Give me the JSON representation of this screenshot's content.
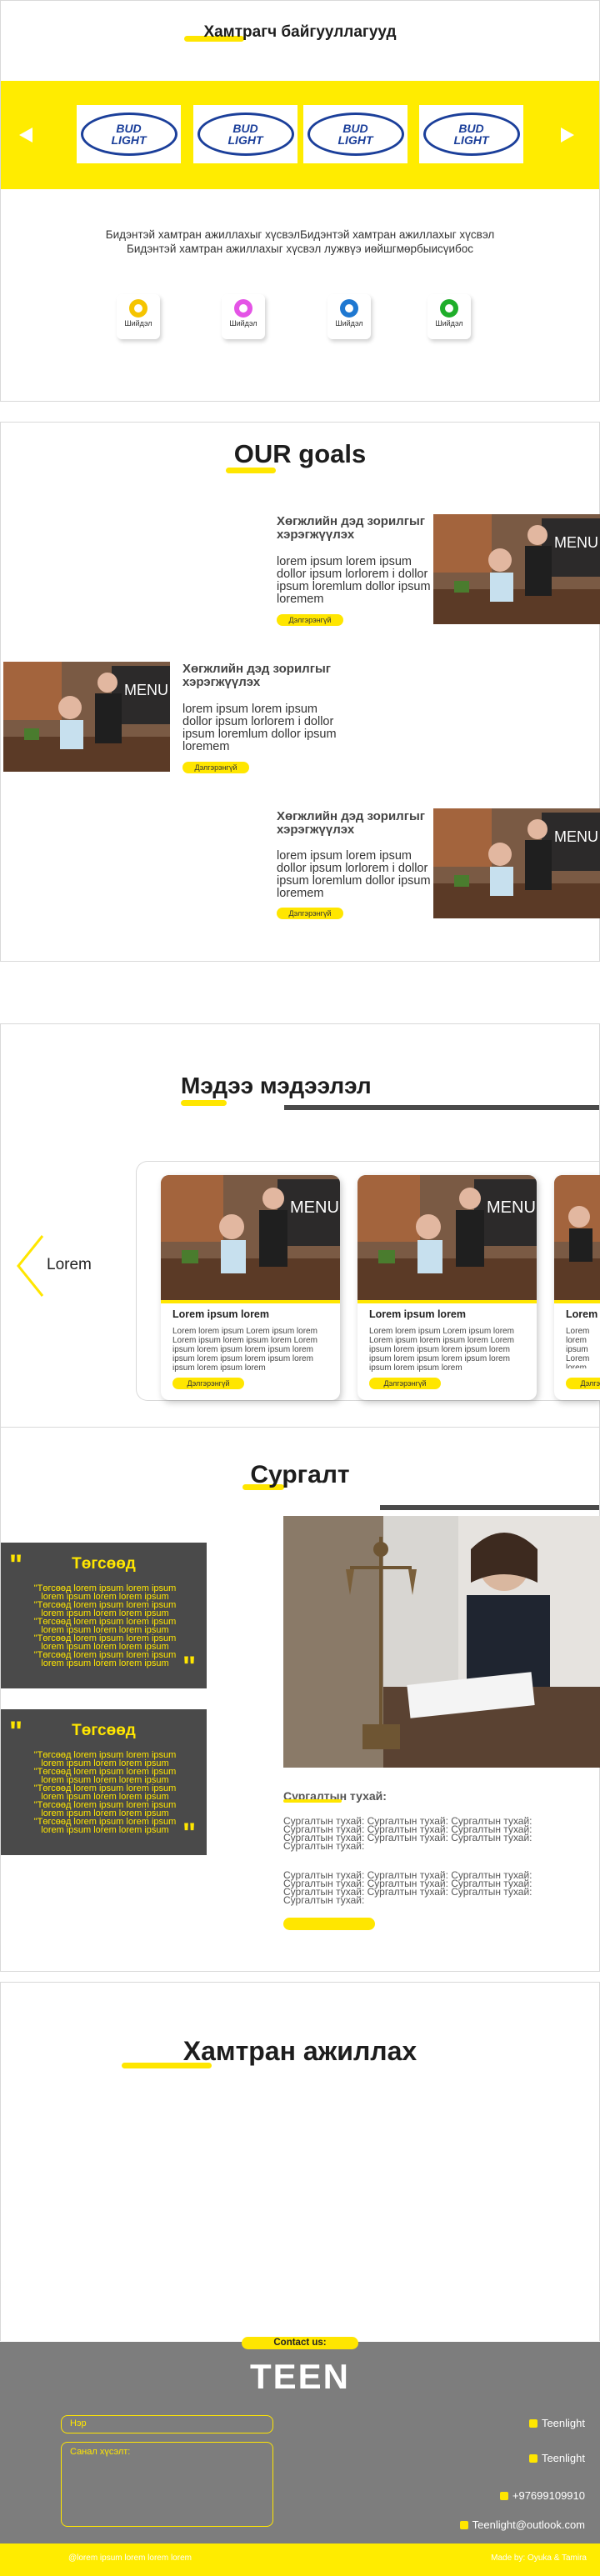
{
  "partners": {
    "title": "Хамтрагч байгууллагууд",
    "logos": [
      {
        "line1": "BUD",
        "line2": "LIGHT"
      },
      {
        "line1": "BUD",
        "line2": "LIGHT"
      },
      {
        "line1": "BUD",
        "line2": "LIGHT"
      },
      {
        "line1": "BUD",
        "line2": "LIGHT"
      }
    ],
    "prev_icon": "triangle-left-icon",
    "next_icon": "triangle-right-icon",
    "description_line1": "Бидэнтэй хамтран ажиллахыг хүсвэлБидэнтэй хамтран ажиллахыг хүсвэл",
    "description_line2": "Бидэнтэй хамтран ажиллахыг хүсвэл лужвүэ иөйшгмөрбыисүибос",
    "awards": [
      {
        "label": "Шийдэл",
        "color": "#f5c400"
      },
      {
        "label": "Шийдэл",
        "color": "#e454e6"
      },
      {
        "label": "Шийдэл",
        "color": "#1f78d1"
      },
      {
        "label": "Шийдэл",
        "color": "#1fae2a"
      }
    ]
  },
  "goals": {
    "title": "OUR goals",
    "items": [
      {
        "title_line1": "Хөгжлийн дэд зорилгыг",
        "title_line2": "хэрэгжүүлэх",
        "text": "lorem ipsum lorem ipsum dollor ipsum lorlorem i dollor ipsum loremlum dollor ipsum loremem",
        "button": "Дэлгэрэнгүй"
      },
      {
        "title_line1": "Хөгжлийн дэд зорилгыг",
        "title_line2": "хэрэгжүүлэх",
        "text": "lorem ipsum lorem ipsum dollor ipsum lorlorem i dollor ipsum loremlum dollor ipsum loremem",
        "button": "Дэлгэрэнгүй"
      },
      {
        "title_line1": "Хөгжлийн дэд зорилгыг",
        "title_line2": "хэрэгжүүлэх",
        "text": "lorem ipsum lorem ipsum dollor ipsum lorlorem i dollor ipsum loremlum dollor ipsum loremem",
        "button": "Дэлгэрэнгүй"
      }
    ]
  },
  "news": {
    "title": "Мэдээ мэдээлэл",
    "side_label": "Lorem",
    "cards": [
      {
        "title": "Lorem ipsum lorem",
        "text": "Lorem lorem ipsum Lorem ipsum lorem Lorem ipsum lorem ipsum lorem Lorem ipsum lorem ipsum lorem ipsum lorem ipsum lorem ipsum lorem ipsum lorem ipsum lorem ipsum lorem",
        "button": "Дэлгэрэнгүй"
      },
      {
        "title": "Lorem ipsum lorem",
        "text": "Lorem lorem ipsum Lorem ipsum lorem Lorem ipsum lorem ipsum lorem Lorem ipsum lorem ipsum lorem ipsum lorem ipsum lorem ipsum lorem ipsum lorem ipsum lorem ipsum lorem",
        "button": "Дэлгэрэнгүй"
      },
      {
        "title": "Lorem",
        "text": "Lorem lorem ipsum Lorem lorem Lorem lorem Lorem lorem Lorem lorem",
        "button": "Дэлгэрэнгүй"
      }
    ]
  },
  "training": {
    "title": "Сургалт",
    "testimonials": [
      {
        "title": "Төгсөөд",
        "text": "\"Төгсөөд lorem ipsum lorem ipsum lorem ipsum lorem lorem ipsum \"Төгсөөд lorem ipsum lorem ipsum lorem ipsum lorem lorem ipsum \"Төгсөөд lorem ipsum lorem ipsum lorem ipsum lorem lorem ipsum \"Төгсөөд lorem ipsum lorem ipsum lorem ipsum lorem lorem ipsum \"Төгсөөд lorem ipsum lorem ipsum lorem ipsum lorem lorem ipsum"
      },
      {
        "title": "Төгсөөд",
        "text": "\"Төгсөөд lorem ipsum lorem ipsum lorem ipsum lorem lorem ipsum \"Төгсөөд lorem ipsum lorem ipsum lorem ipsum lorem lorem ipsum \"Төгсөөд lorem ipsum lorem ipsum lorem ipsum lorem lorem ipsum \"Төгсөөд lorem ipsum lorem ipsum lorem ipsum lorem lorem ipsum \"Төгсөөд lorem ipsum lorem ipsum lorem ipsum lorem lorem ipsum"
      }
    ],
    "about_title": "Сургалтын тухай:",
    "about_text_1": "Сургалтын тухай: Сургалтын тухай: Сургалтын тухай: Сургалтын тухай: Сургалтын тухай: Сургалтын тухай: Сургалтын тухай: Сургалтын тухай: Сургалтын тухай: Сургалтын тухай:",
    "about_text_2": "Сургалтын тухай: Сургалтын тухай: Сургалтын тухай: Сургалтын тухай: Сургалтын тухай: Сургалтын тухай: Сургалтын тухай: Сургалтын тухай: Сургалтын тухай: Сургалтын тухай:"
  },
  "cooperate": {
    "title": "Хамтран ажиллах"
  },
  "contact": {
    "label": "Contact us:",
    "brand": "TEEN",
    "name_placeholder": "Нэр",
    "message_placeholder": "Санал хүсэлт:",
    "items": [
      "Teenlight",
      "Teenlight",
      "+97699109910",
      "Teenlight@outlook.com"
    ],
    "footer_left": "@lorem ipsum lorem lorem lorem",
    "footer_right": "Made by: Oyuka & Tamira"
  }
}
